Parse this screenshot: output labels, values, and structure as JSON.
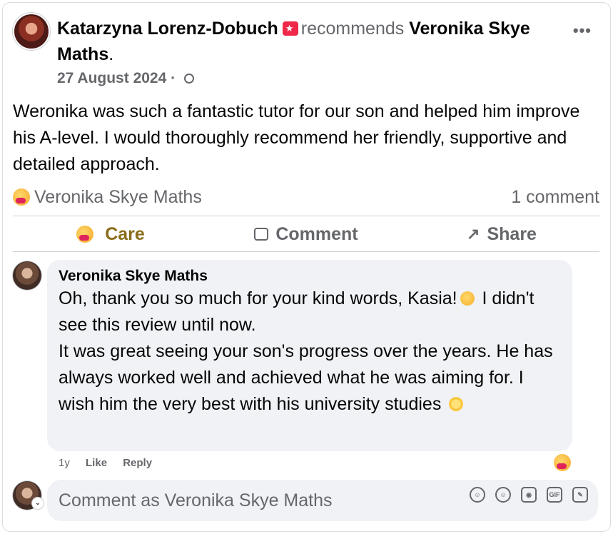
{
  "post": {
    "author": "Katarzyna Lorenz-Dobuch",
    "verb": "recommends",
    "page": "Veronika Skye Maths",
    "date": "27 August 2024",
    "date_sep": " · ",
    "text": "Weronika was such a fantastic tutor for our son and helped him improve his A-level. I would thoroughly recommend her friendly, supportive and detailed approach."
  },
  "stats": {
    "reactor": "Veronika Skye Maths",
    "comments": "1 comment"
  },
  "actions": {
    "care": "Care",
    "comment": "Comment",
    "share": "Share"
  },
  "comment": {
    "author": "Veronika Skye Maths",
    "line1": "Oh, thank you so much for your kind words, Kasia!",
    "line1b": "I didn't see this review until now.",
    "line2": "It was great seeing your son's progress over the years. He has always worked well and achieved what he was aiming for. I wish him the very best with his university studies",
    "age": "1y",
    "like": "Like",
    "reply": "Reply"
  },
  "composer": {
    "placeholder": "Comment as Veronika Skye Maths",
    "tools": [
      "avatar-sticker-icon",
      "emoji-icon",
      "camera-icon",
      "gif-icon",
      "sticker-icon"
    ]
  },
  "colors": {
    "care_text": "#8a6d1b",
    "secondary": "#65676b",
    "bubble": "#f0f2f5",
    "badge": "#f02849"
  }
}
